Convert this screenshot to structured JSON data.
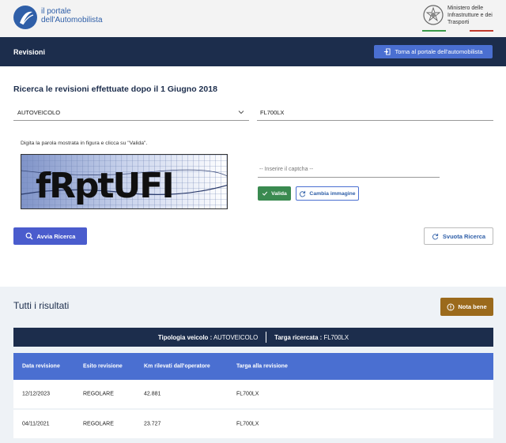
{
  "header": {
    "logo_line1": "il portale",
    "logo_line2": "dell'Automobilista",
    "ministry_line1": "Ministero delle",
    "ministry_line2": "Infrastrutture e dei",
    "ministry_line3": "Trasporti"
  },
  "navbar": {
    "title": "Revisioni",
    "back_button": "Torna al portale dell'automobilista"
  },
  "search": {
    "heading": "Ricerca le revisioni effettuate dopo il 1 Giugno 2018",
    "vehicle_type": "AUTOVEICOLO",
    "plate": "FL700LX",
    "captcha_hint": "Digita la parola mostrata in figura e clicca su \"Valida\".",
    "captcha_text": "fRptUFI",
    "captcha_placeholder": "-- Inserire il captcha --",
    "valida_label": "Valida",
    "cambia_label": "Cambia immagine",
    "avvia_label": "Avvia Ricerca",
    "svuota_label": "Svuota Ricerca"
  },
  "results": {
    "heading": "Tutti i risultati",
    "nota_label": "Nota bene",
    "summary_type_label": "Tipologia veicolo :",
    "summary_type_value": "AUTOVEICOLO",
    "summary_plate_label": "Targa ricercata :",
    "summary_plate_value": "FL700LX",
    "columns": [
      "Data revisione",
      "Esito revisione",
      "Km rilevati dall'operatore",
      "Targa alla revisione"
    ],
    "rows": [
      [
        "12/12/2023",
        "REGOLARE",
        "42.881",
        "FL700LX"
      ],
      [
        "04/11/2021",
        "REGOLARE",
        "23.727",
        "FL700LX"
      ]
    ]
  }
}
